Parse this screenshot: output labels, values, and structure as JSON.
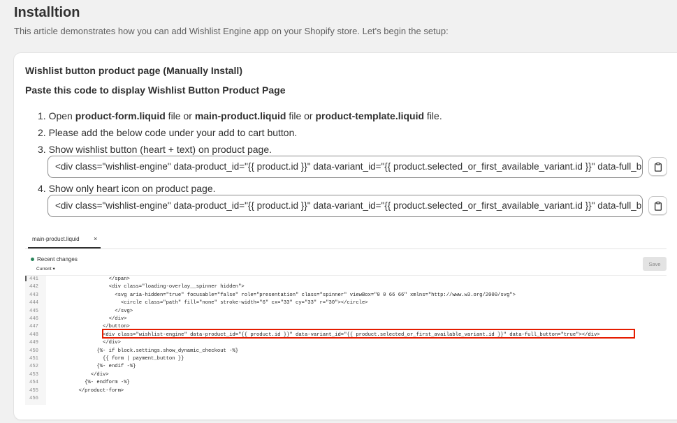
{
  "header": {
    "title": "Installtion",
    "description": "This article demonstrates how you can add Wishlist Engine app on your Shopify store. Let's begin the setup:"
  },
  "card": {
    "title": "Wishlist button product page (Manually Install)",
    "subtitle": "Paste this code to display Wishlist Button Product Page",
    "steps": {
      "s1": {
        "n": "1. Open ",
        "b1": "product-form.liquid",
        "t1": " file or ",
        "b2": "main-product.liquid",
        "t2": " file or ",
        "b3": "product-template.liquid",
        "t3": " file."
      },
      "s2": "2. Please add the below code under your add to cart button.",
      "s3": "3. Show wishlist button (heart + text) on product page.",
      "s4": "4. Show only heart icon on product page."
    },
    "code1": "<div class=\"wishlist-engine\" data-product_id=\"{{  product.id }}\" data-variant_id=\"{{ product.selected_or_first_available_variant.id }}\" data-full_button=\"true\"></div>",
    "code2": "<div class=\"wishlist-engine\" data-product_id=\"{{  product.id }}\" data-variant_id=\"{{ product.selected_or_first_available_variant.id }}\" data-full_button=\"false\"></div>"
  },
  "editor": {
    "tab": "main-product.liquid",
    "tab_close": "×",
    "recent": "Recent changes",
    "current": "Current ▾",
    "save": "Save",
    "lines": [
      {
        "n": "441",
        "code": "                  </span>"
      },
      {
        "n": "442",
        "code": "                  <div class=\"loading-overlay__spinner hidden\">"
      },
      {
        "n": "443",
        "code": "                    <svg aria-hidden=\"true\" focusable=\"false\" role=\"presentation\" class=\"spinner\" viewBox=\"0 0 66 66\" xmlns=\"http://www.w3.org/2000/svg\">"
      },
      {
        "n": "444",
        "code": "                      <circle class=\"path\" fill=\"none\" stroke-width=\"6\" cx=\"33\" cy=\"33\" r=\"30\"></circle>"
      },
      {
        "n": "445",
        "code": "                    </svg>"
      },
      {
        "n": "446",
        "code": "                  </div>"
      },
      {
        "n": "447",
        "code": "                </button>"
      },
      {
        "n": "448",
        "code": "                <div class=\"wishlist-engine\" data-product_id=\"{{ product.id }}\" data-variant_id=\"{{ product.selected_or_first_available_variant.id }}\" data-full_button=\"true\"></div>"
      },
      {
        "n": "449",
        "code": "                </div>"
      },
      {
        "n": "450",
        "code": "              {%- if block.settings.show_dynamic_checkout -%}"
      },
      {
        "n": "451",
        "code": "                {{ form | payment_button }}"
      },
      {
        "n": "452",
        "code": "              {%- endif -%}"
      },
      {
        "n": "453",
        "code": "            </div>"
      },
      {
        "n": "454",
        "code": "          {%- endform -%}"
      },
      {
        "n": "455",
        "code": "        </product-form>"
      },
      {
        "n": "456",
        "code": ""
      }
    ]
  },
  "colors": {
    "accent_highlight": "#e51c00",
    "recent_dot": "#29845a"
  },
  "icons": {
    "copy": "clipboard-icon"
  }
}
